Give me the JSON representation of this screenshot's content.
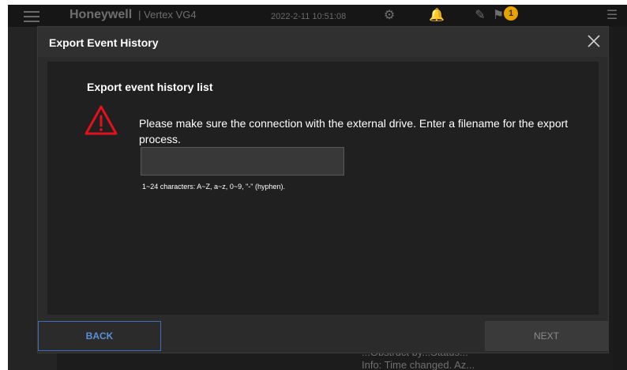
{
  "background_app": {
    "brand": "Honeywell",
    "product": "| Vertex VG4",
    "datetime": "2022-2-11 10:51:08",
    "alarm_count": "1",
    "footer_line1": "...Obstruct by...Status...",
    "footer_line2": "Info: Time changed. Az..."
  },
  "dialog": {
    "title": "Export Event History",
    "section_title": "Export event history list",
    "message": "Please make sure the connection with the external drive. Enter a filename for the export process.",
    "filename_value": "",
    "filename_placeholder": "",
    "hint": "1~24 characters: A~Z, a~z, 0~9, \"-\" (hyphen).",
    "back_label": "BACK",
    "next_label": "NEXT"
  },
  "colors": {
    "warning": "#e0121b",
    "back_border": "#3c6fb7",
    "alarm_badge": "#e8a200"
  }
}
